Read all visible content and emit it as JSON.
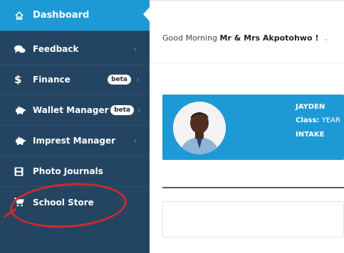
{
  "sidebar": {
    "items": [
      {
        "label": "Dashboard",
        "icon": "home-icon"
      },
      {
        "label": "Feedback",
        "icon": "chat-bubbles-icon",
        "chevron": "‹"
      },
      {
        "label": "Finance",
        "icon": "dollar-icon",
        "badge": "beta",
        "chevron": "‹"
      },
      {
        "label": "Wallet Manager",
        "icon": "piggy-bank-icon",
        "badge": "beta",
        "chevron": "‹"
      },
      {
        "label": "Imprest Manager",
        "icon": "piggy-bank-icon",
        "chevron": "‹"
      },
      {
        "label": "Photo Journals",
        "icon": "film-icon"
      },
      {
        "label": "School Store",
        "icon": "shopping-cart-icon"
      }
    ]
  },
  "header": {
    "greeting_prefix": "Good Morning",
    "greeting_name": "Mr & Mrs Akpotohwo !",
    "caret": "⌄"
  },
  "student": {
    "name": "JAYDEN",
    "class_label": "Class:",
    "class_value": "YEAR",
    "intake": "INTAKE"
  },
  "colors": {
    "sidebar_bg": "#234562",
    "accent": "#1d9ad6",
    "annotation": "#cc2b2b"
  }
}
